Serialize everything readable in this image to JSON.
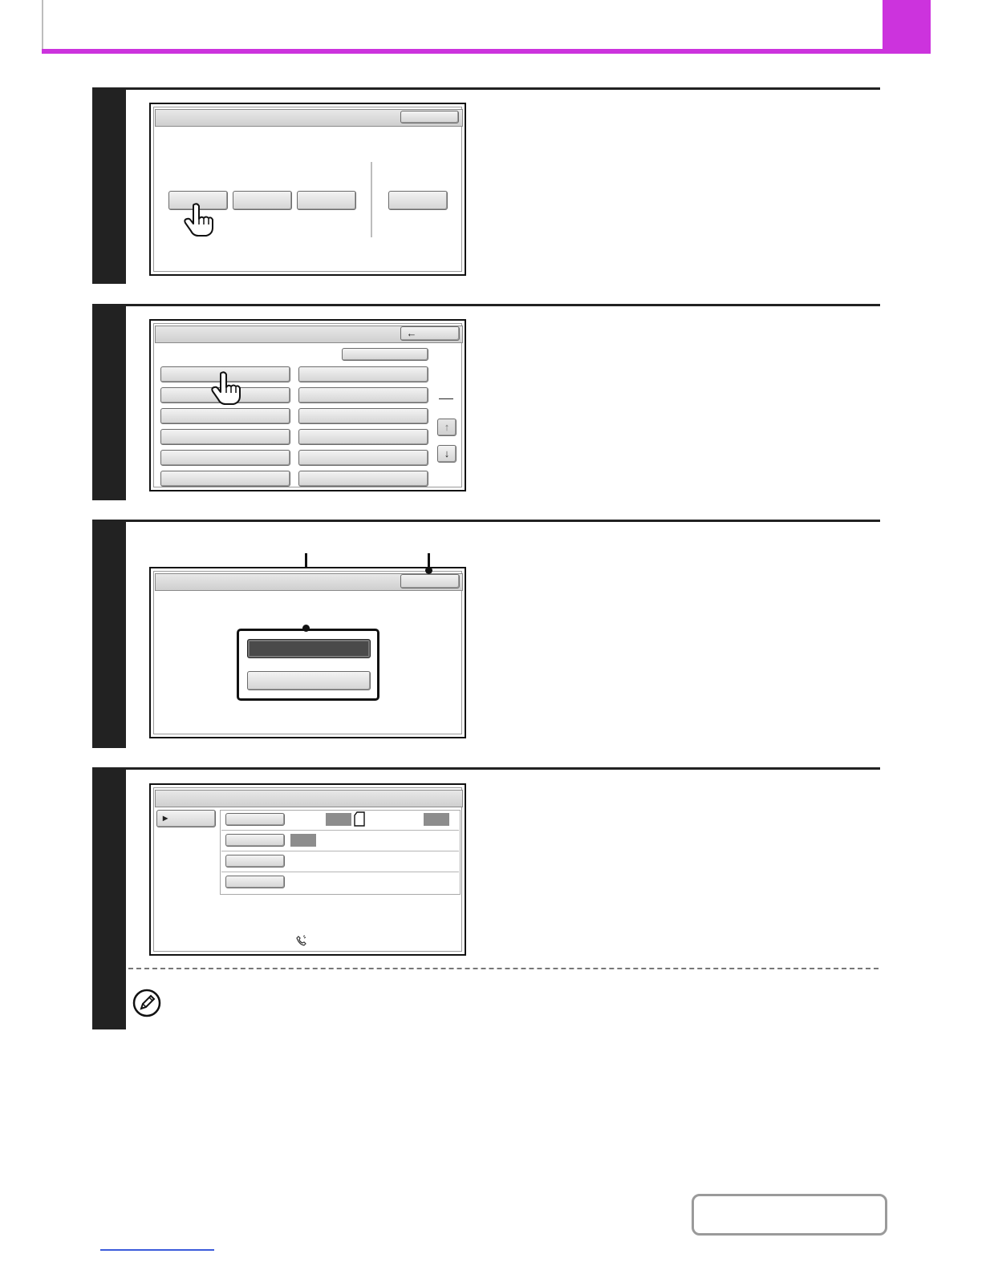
{
  "colors": {
    "accent": "#cc33dd",
    "step_bar": "#222222"
  },
  "icons": {
    "pointer": "pointing-hand-icon",
    "back": "back-arrow-icon",
    "scroll_up": "arrow-up-icon",
    "scroll_down": "arrow-down-icon",
    "note": "pencil-note-icon",
    "play": "play-triangle-icon",
    "page": "page-icon",
    "phone": "phone-icon"
  },
  "glyphs": {
    "back": "←",
    "up": "↑",
    "down": "↓",
    "play": "▸"
  }
}
